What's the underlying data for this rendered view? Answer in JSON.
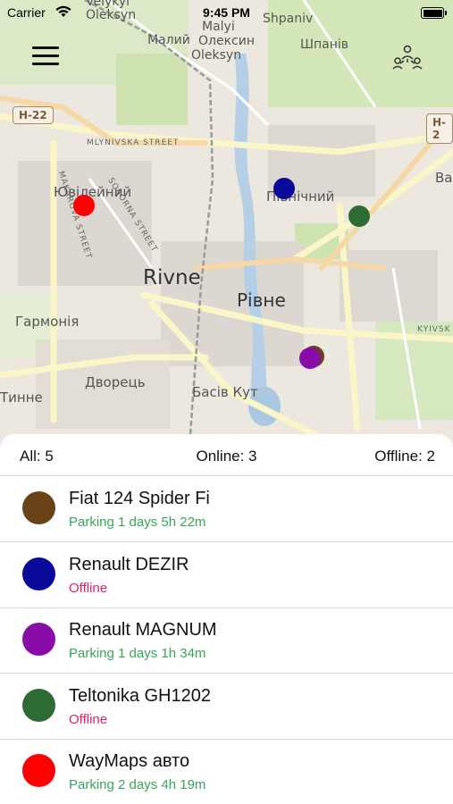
{
  "status_bar": {
    "carrier": "Carrier",
    "time": "9:45 PM"
  },
  "map": {
    "labels": {
      "rivne": "Rivne",
      "rivne_cyr": "Рівне",
      "velykyi": "Velykyi",
      "oleksyn_top": "Oleksyn",
      "malyi_cyr": "Малий",
      "malyi_oleksyn_cyr": "Олексин",
      "malyi_lat": "Malyi",
      "oleksyn_lat": "Oleksyn",
      "shpaniv": "Shpaniv",
      "shpaniv_cyr": "Шпанів",
      "yuvileinyi": "Ювілейний",
      "pivnichnyi": "Північний",
      "harmoniia": "Гармонія",
      "dvorets": "Дворець",
      "basiv_kut": "Басів Кут",
      "tynne": "Тинне",
      "va": "Ва",
      "h22_left": "H-22",
      "h22_right": "H-2"
    },
    "streets": {
      "mlynivska": "MLYNIVSKA STREET",
      "makarova": "MAKAROVA STREET",
      "soborna": "SOBORNA STREET",
      "kyivska": "KYIVSK"
    },
    "markers": [
      {
        "color": "#0a0a9a"
      },
      {
        "color": "#2e6b35"
      },
      {
        "color": "#ff0000"
      },
      {
        "color": "#6a4a1a"
      },
      {
        "color": "#8a0ca8"
      }
    ]
  },
  "summary": {
    "all": "All: 5",
    "online": "Online: 3",
    "offline": "Offline: 2"
  },
  "vehicles": [
    {
      "name": "Fiat 124 Spider Fi",
      "status": "Parking 1 days 5h 22m",
      "status_color": "#3aa45a",
      "color": "#6a4217"
    },
    {
      "name": "Renault DEZIR",
      "status": "Offline",
      "status_color": "#e0245e",
      "color": "#0a0a9a"
    },
    {
      "name": "Renault MAGNUM",
      "status": "Parking 1 days 1h 34m",
      "status_color": "#3aa45a",
      "color": "#8a0ca8"
    },
    {
      "name": "Teltonika GH1202",
      "status": "Offline",
      "status_color": "#e0245e",
      "color": "#2e6b35"
    },
    {
      "name": "WayMaps авто",
      "status": "Parking 2 days 4h 19m",
      "status_color": "#3aa45a",
      "color": "#ff0000"
    }
  ],
  "icons": {
    "menu": "hamburger-menu-icon",
    "users": "users-network-icon",
    "wifi": "wifi-icon",
    "battery": "battery-icon"
  }
}
